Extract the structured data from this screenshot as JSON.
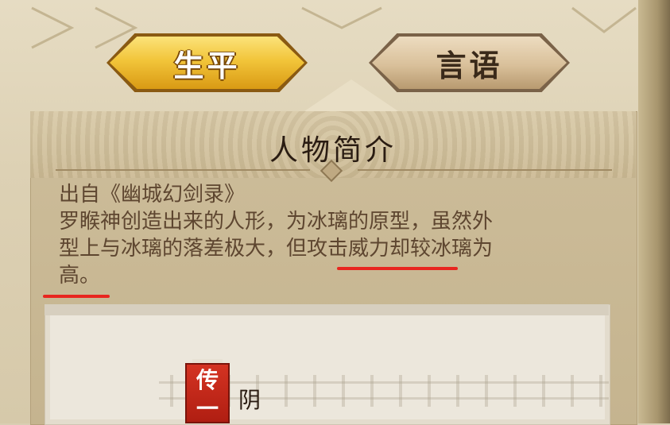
{
  "tabs": {
    "active_label": "生平",
    "inactive_label": "言语"
  },
  "card": {
    "title": "人物简介",
    "description_lines": [
      "出自《幽城幻剑录》",
      "罗睺神创造出来的人形，为冰璃的原型，虽然外",
      "型上与冰璃的落差极大，但攻击威力却较冰璃为",
      "高。"
    ]
  },
  "character": {
    "badge_chars": [
      "传",
      "一"
    ],
    "name_partial": "阴"
  },
  "colors": {
    "active_tab": "#f2c53a",
    "inactive_tab": "#d9c09a",
    "annotation_underline": "#e8261f",
    "badge_red": "#c82818"
  }
}
